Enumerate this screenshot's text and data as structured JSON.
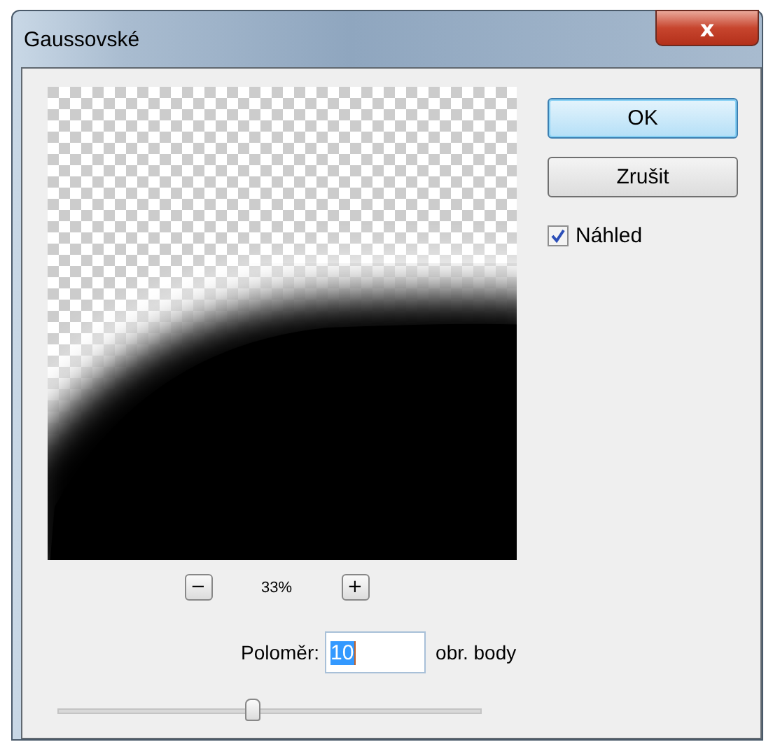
{
  "window": {
    "title": "Gaussovské",
    "close_label": "x"
  },
  "buttons": [
    {
      "label": "OK",
      "default": true
    },
    {
      "label": "Zrušit",
      "default": false
    }
  ],
  "preview_checkbox": {
    "label": "Náhled",
    "checked": true
  },
  "zoom": {
    "minus": "−",
    "value": "33%",
    "plus": "+"
  },
  "radius": {
    "label": "Poloměr:",
    "value": "10",
    "unit": "obr. body",
    "level": 0.46
  }
}
